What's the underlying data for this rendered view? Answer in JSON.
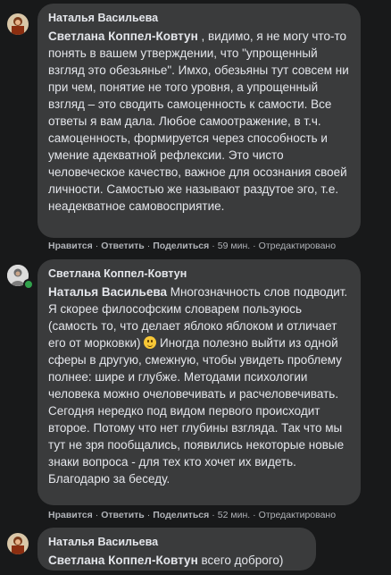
{
  "comments": [
    {
      "author": "Наталья Васильева",
      "mention": "Светлана Коппел-Ковтун",
      "text": " , видимо, я не могу что-то понять в вашем утверждении, что \"упрощенный взгляд это обезьянье\". Имхо, обезьяны тут совсем ни при чем, понятие не того уровня, а упрощенный взгляд – это сводить самоценность к самости. Все ответы я вам дала. Любое самоотражение, в т.ч. самоценность, формируется через способность и умение адекватной рефлексии. Это чисто человеческое качество, важное для осознания своей личности. Самостью же называют раздутое эго, т.е. неадекватное самовосприятие.",
      "like": "Нравится",
      "reply": "Ответить",
      "share": "Поделиться",
      "time": "59 мин.",
      "edited": "Отредактировано"
    },
    {
      "author": "Светлана Коппел-Ковтун",
      "mention": "Наталья Васильева",
      "text_before_emoji": " Многозначность слов подводит. Я скорее философским словарем пользуюсь (самость то, что делает яблоко яблоком и отличает его от морковки) ",
      "emoji": "smile-emoji",
      "text_after_emoji": " Иногда полезно выйти из одной сферы в другую, смежную, чтобы увидеть проблему полнее: шире и глубже. Методами психологии человека можно очеловечивать и расчеловечивать. Сегодня нередко под видом первого происходит второе. Потому что нет глубины взгляда. Так что мы тут не зря пообщались, появились некоторые новые знаки вопроса - для тех кто хочет их видеть. Благодарю за беседу.",
      "like": "Нравится",
      "reply": "Ответить",
      "share": "Поделиться",
      "time": "52 мин.",
      "edited": "Отредактировано"
    },
    {
      "author": "Наталья Васильева",
      "mention": "Светлана Коппел-Ковтун",
      "text": " всего доброго)"
    }
  ],
  "separator": "·",
  "colors": {
    "background": "#18191a",
    "bubble": "#3a3b3c",
    "text": "#e4e6eb",
    "secondary_text": "#b0b3b8",
    "online": "#31a24c"
  }
}
